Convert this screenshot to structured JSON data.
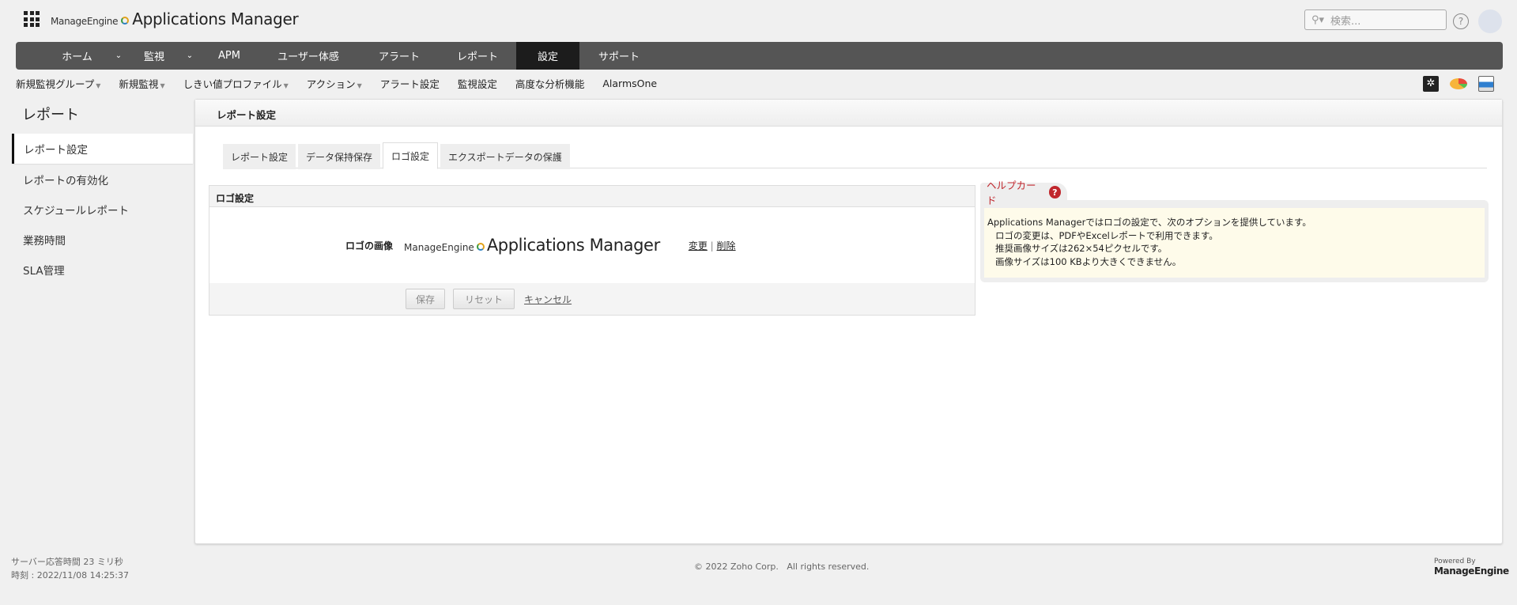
{
  "header": {
    "brand_small": "ManageEngine",
    "brand_title": "Applications Manager",
    "search_placeholder": "検索...",
    "help": "?"
  },
  "nav": {
    "items": [
      {
        "label": "ホーム"
      },
      {
        "label": "監視"
      },
      {
        "label": "APM"
      },
      {
        "label": "ユーザー体感"
      },
      {
        "label": "アラート"
      },
      {
        "label": "レポート"
      },
      {
        "label": "設定",
        "active": true
      },
      {
        "label": "サポート"
      }
    ]
  },
  "subnav": {
    "items": [
      "新規監視グループ",
      "新規監視",
      "しきい値プロファイル",
      "アクション",
      "アラート設定",
      "監視設定",
      "高度な分析機能",
      "AlarmsOne"
    ]
  },
  "sidebar": {
    "title": "レポート",
    "items": [
      "レポート設定",
      "レポートの有効化",
      "スケジュールレポート",
      "業務時間",
      "SLA管理"
    ]
  },
  "main": {
    "header": "レポート設定",
    "tabs": [
      "レポート設定",
      "データ保持保存",
      "ロゴ設定",
      "エクスポートデータの保護"
    ],
    "logo_box": {
      "title": "ロゴ設定",
      "label": "ロゴの画像",
      "logo_small": "ManageEngine",
      "logo_title": "Applications Manager",
      "change": "変更",
      "sep": "|",
      "delete": "削除",
      "save": "保存",
      "reset": "リセット",
      "cancel": "キャンセル"
    },
    "help_card": {
      "title": "ヘルプカード",
      "lines": [
        "Applications Managerではロゴの設定で、次のオプションを提供しています。",
        "ロゴの変更は、PDFやExcelレポートで利用できます。",
        "推奨画像サイズは262×54ピクセルです。",
        "画像サイズは100 KBより大きくできません。"
      ]
    }
  },
  "footer": {
    "response": "サーバー応答時間 23 ミリ秒",
    "time": "時刻 : 2022/11/08 14:25:37",
    "copyright": "© 2022 Zoho Corp.   All rights reserved.",
    "powered": "Powered By",
    "powered_brand": "ManageEngine"
  }
}
